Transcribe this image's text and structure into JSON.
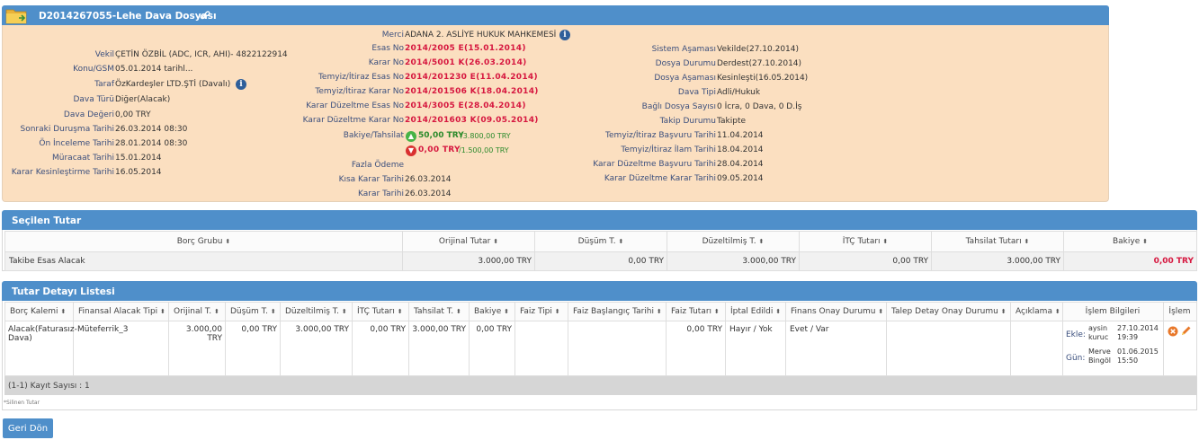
{
  "case": {
    "title": "D2014267055-Lehe Dava Dosyası"
  },
  "left_fields": [
    {
      "label": "Vekil",
      "value": "ÇETİN ÖZBİL (ADC, ICR, AHI)- 4822122914"
    },
    {
      "label": "Konu/GSM",
      "value": "05.01.2014 tarihl..."
    },
    {
      "label": "Taraf",
      "value": "ÖzKardeşler LTD.ŞTİ  (Davalı)"
    },
    {
      "label": "Dava Türü",
      "value": "Diğer(Alacak)"
    },
    {
      "label": "Dava Değeri",
      "value": "0,00 TRY"
    },
    {
      "label": "Sonraki Duruşma Tarihi",
      "value": "26.03.2014 08:30"
    },
    {
      "label": "Ön İnceleme Tarihi",
      "value": "28.01.2014 08:30"
    },
    {
      "label": "Müracaat Tarihi",
      "value": "15.01.2014"
    },
    {
      "label": "Karar Kesinleştirme Tarihi",
      "value": "16.05.2014"
    }
  ],
  "mid_fields": {
    "merci": {
      "label": "Merci",
      "value": "ADANA 2. ASLİYE HUKUK MAHKEMESİ"
    },
    "red_rows": [
      {
        "label": "Esas No",
        "value": "2014/2005 E(15.01.2014)"
      },
      {
        "label": "Karar No",
        "value": "2014/5001 K(26.03.2014)"
      },
      {
        "label": "Temyiz/İtiraz Esas No",
        "value": "2014/201230 E(11.04.2014)"
      },
      {
        "label": "Temyiz/İtiraz Karar No",
        "value": "2014/201506 K(18.04.2014)"
      },
      {
        "label": "Karar Düzeltme Esas No",
        "value": "2014/3005 E(28.04.2014)"
      },
      {
        "label": "Karar Düzeltme Karar No",
        "value": "2014/201603 K(09.05.2014)"
      }
    ],
    "bakiye": {
      "label": "Bakiye/Tahsilat",
      "up_value": "50,00 TRY",
      "up_total": "/3.800,00 TRY",
      "down_value": "0,00 TRY",
      "down_total": "/1.500,00 TRY"
    },
    "fazla": {
      "label": "Fazla Ödeme",
      "value": ""
    },
    "kisa": {
      "label": "Kısa Karar Tarihi",
      "value": "26.03.2014"
    },
    "karar": {
      "label": "Karar Tarihi",
      "value": "26.03.2014"
    }
  },
  "right_fields": [
    {
      "label": "Sistem Aşaması",
      "value": "Vekilde(27.10.2014)"
    },
    {
      "label": "Dosya Durumu",
      "value": "Derdest(27.10.2014)"
    },
    {
      "label": "Dosya Aşaması",
      "value": "Kesinleşti(16.05.2014)"
    },
    {
      "label": "Dava Tipi",
      "value": "Adli/Hukuk"
    },
    {
      "label": "Bağlı Dosya Sayısı",
      "value": "0 İcra, 0 Dava, 0 D.İş"
    },
    {
      "label": "Takip Durumu",
      "value": "Takipte"
    },
    {
      "label": "Temyiz/İtiraz Başvuru Tarihi",
      "value": "11.04.2014"
    },
    {
      "label": "Temyiz/İtiraz İlam Tarihi",
      "value": "18.04.2014"
    },
    {
      "label": "Karar Düzeltme Başvuru Tarihi",
      "value": "28.04.2014"
    },
    {
      "label": "Karar Düzeltme Karar Tarihi",
      "value": "09.05.2014"
    }
  ],
  "selected": {
    "title": "Seçilen Tutar",
    "columns": [
      "Borç Grubu",
      "Orijinal Tutar",
      "Düşüm T.",
      "Düzeltilmiş T.",
      "İTÇ Tutarı",
      "Tahsilat Tutarı",
      "Bakiye"
    ],
    "sort_icon": "⬍",
    "row": [
      "Takibe Esas Alacak",
      "3.000,00 TRY",
      "0,00 TRY",
      "3.000,00 TRY",
      "0,00 TRY",
      "3.000,00 TRY",
      "0,00 TRY"
    ]
  },
  "detail": {
    "title": "Tutar Detayı Listesi",
    "columns": [
      "Borç Kalemi",
      "Finansal Alacak Tipi",
      "Orijinal T.",
      "Düşüm T.",
      "Düzeltilmiş T.",
      "İTÇ Tutarı",
      "Tahsilat T.",
      "Bakiye",
      "Faiz Tipi",
      "Faiz Başlangıç Tarihi",
      "Faiz Tutarı",
      "İptal Edildi",
      "Finans Onay Durumu",
      "Talep Detay Onay Durumu",
      "Açıklama",
      "İşlem Bilgileri",
      "İşlem"
    ],
    "row": {
      "borc_kalemi": "Alacak(Faturasız-Dava)",
      "finansal_tip": "Müteferrik_3",
      "orijinal": "3.000,00 TRY",
      "dusum": "0,00 TRY",
      "duzeltilmis": "3.000,00 TRY",
      "itc": "0,00 TRY",
      "tahsilat": "3.000,00 TRY",
      "bakiye": "0,00 TRY",
      "faiz_tipi": "",
      "faiz_baslangic": "",
      "faiz_tutari": "0,00 TRY",
      "iptal": "Hayır / Yok",
      "finans_onay": "Evet / Var",
      "talep_onay": "",
      "aciklama": "",
      "ekle_label": "Ekle:",
      "ekle_user": "aysin kuruc",
      "ekle_date": "27.10.2014",
      "ekle_time": "19:39",
      "gun_label": "Gün:",
      "gun_user": "Merve Bingöl",
      "gun_date": "01.06.2015",
      "gun_time": "15:50"
    },
    "footer": "(1-1) Kayıt Sayısı : 1",
    "note": "*Silinen Tutar"
  },
  "back_button": "Geri Dön",
  "colors": {
    "header": "#4f8fca",
    "panel": "#fbdfc0",
    "red": "#d6173f",
    "green": "#2b8a2b"
  }
}
